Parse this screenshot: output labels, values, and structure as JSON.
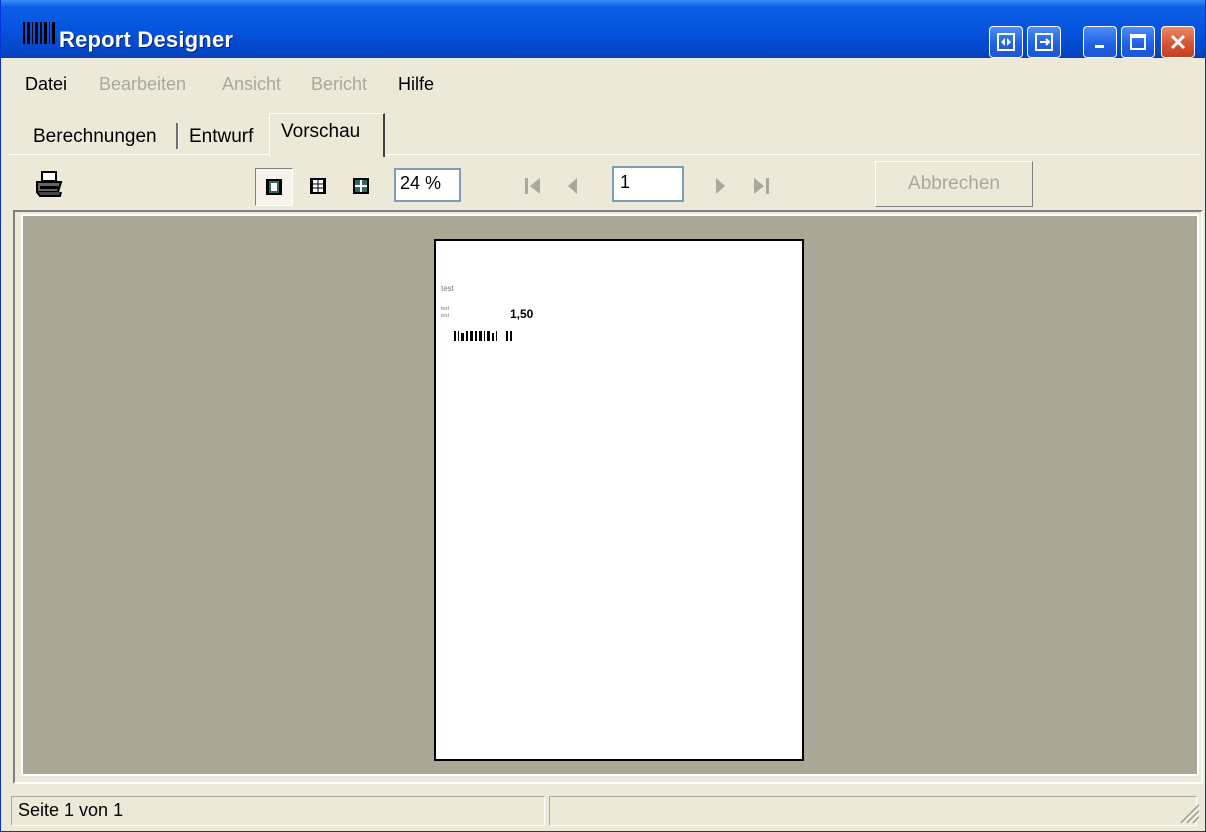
{
  "window": {
    "title": "Report Designer"
  },
  "menu": {
    "items": [
      {
        "label": "Datei",
        "enabled": true
      },
      {
        "label": "Bearbeiten",
        "enabled": false
      },
      {
        "label": "Ansicht",
        "enabled": false
      },
      {
        "label": "Bericht",
        "enabled": false
      },
      {
        "label": "Hilfe",
        "enabled": true
      }
    ]
  },
  "tabs": {
    "items": [
      {
        "label": "Berechnungen",
        "active": false
      },
      {
        "label": "Entwurf",
        "active": false
      },
      {
        "label": "Vorschau",
        "active": true
      }
    ]
  },
  "toolbar": {
    "print_icon": "printer-icon",
    "view_icons": [
      "single-page-icon",
      "two-pages-icon",
      "multi-page-icon"
    ],
    "zoom_value": "24 %",
    "page_value": "1",
    "nav_icons": [
      "first-page-icon",
      "previous-page-icon",
      "next-page-icon",
      "last-page-icon"
    ],
    "cancel_label": "Abbrechen",
    "cancel_enabled": false
  },
  "preview": {
    "title_text": "test",
    "small_labels": [
      "text",
      "text"
    ],
    "value": "1,50"
  },
  "status": {
    "page_text": "Seite 1 von 1"
  },
  "colors": {
    "title_blue": "#0654DE",
    "window_face": "#ECE9D8",
    "preview_background": "#ABA797",
    "disabled_text": "#ACA899"
  }
}
